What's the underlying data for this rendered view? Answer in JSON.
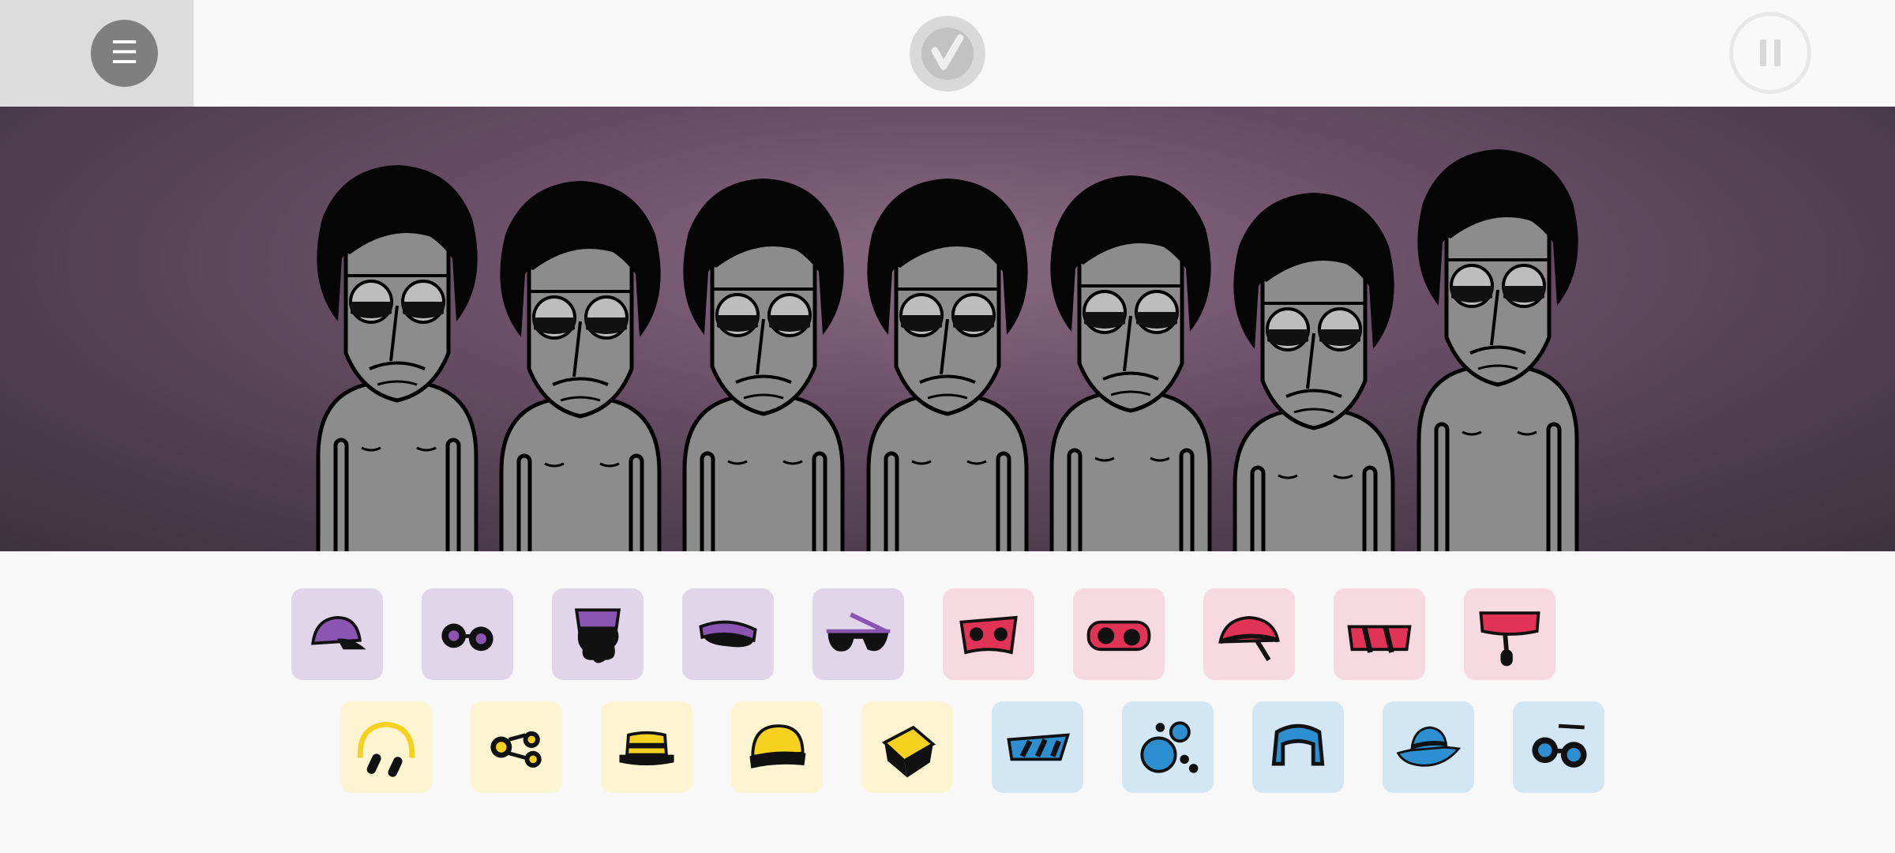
{
  "toolbar": {
    "menu_icon": "menu-icon",
    "menu_glyph": "☰",
    "logo_icon": "incredibox-logo-icon",
    "pause_icon": "pause-icon"
  },
  "stage": {
    "characters": [
      {
        "slot": 1,
        "state": "idle"
      },
      {
        "slot": 2,
        "state": "idle"
      },
      {
        "slot": 3,
        "state": "idle"
      },
      {
        "slot": 4,
        "state": "idle"
      },
      {
        "slot": 5,
        "state": "idle"
      },
      {
        "slot": 6,
        "state": "idle"
      },
      {
        "slot": 7,
        "state": "idle"
      }
    ]
  },
  "sound_icons": {
    "row1": [
      {
        "name": "cap-icon",
        "category": "beats",
        "color": "#8a55b0"
      },
      {
        "name": "goggles-icon",
        "category": "beats",
        "color": "#8a55b0"
      },
      {
        "name": "hair-icon",
        "category": "beats",
        "color": "#8a55b0"
      },
      {
        "name": "visor-icon",
        "category": "beats",
        "color": "#8a55b0"
      },
      {
        "name": "sunglasses-icon",
        "category": "beats",
        "color": "#8a55b0"
      },
      {
        "name": "mask-icon",
        "category": "effects",
        "color": "#e03355"
      },
      {
        "name": "glasses-icon",
        "category": "effects",
        "color": "#e03355"
      },
      {
        "name": "bandana-icon",
        "category": "effects",
        "color": "#e03355"
      },
      {
        "name": "scarf-icon",
        "category": "effects",
        "color": "#e03355"
      },
      {
        "name": "headband-mic-icon",
        "category": "effects",
        "color": "#e03355"
      }
    ],
    "row2": [
      {
        "name": "headphones-icon",
        "category": "melodies",
        "color": "#f5d21f"
      },
      {
        "name": "binoculars-icon",
        "category": "melodies",
        "color": "#f5d21f"
      },
      {
        "name": "boater-hat-icon",
        "category": "melodies",
        "color": "#f5d21f"
      },
      {
        "name": "beanie-icon",
        "category": "melodies",
        "color": "#f5d21f"
      },
      {
        "name": "cube-icon",
        "category": "melodies",
        "color": "#f5d21f"
      },
      {
        "name": "striped-visor-icon",
        "category": "voices",
        "color": "#2d8fd0"
      },
      {
        "name": "bubbles-icon",
        "category": "voices",
        "color": "#2d8fd0"
      },
      {
        "name": "hood-icon",
        "category": "voices",
        "color": "#2d8fd0"
      },
      {
        "name": "fedora-icon",
        "category": "voices",
        "color": "#2d8fd0"
      },
      {
        "name": "round-goggles-icon",
        "category": "voices",
        "color": "#2d8fd0"
      }
    ]
  }
}
